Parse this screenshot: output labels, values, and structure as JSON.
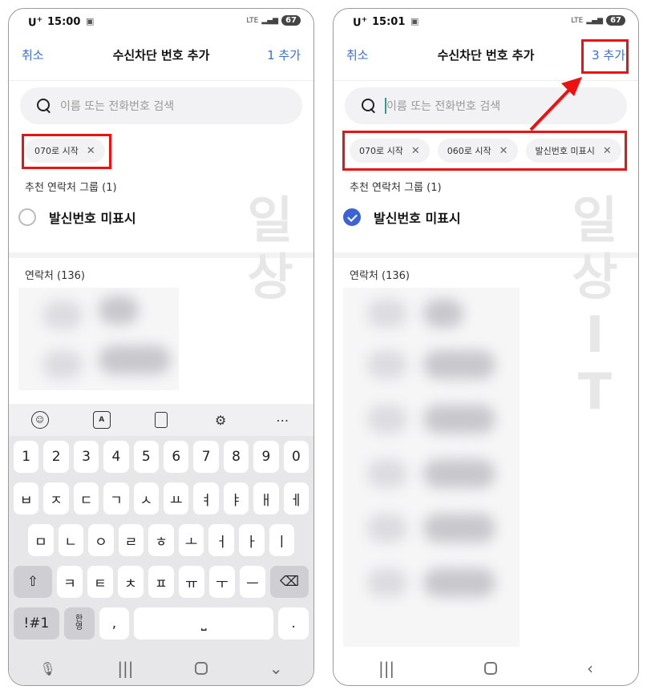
{
  "left": {
    "status": {
      "carrier": "U",
      "carrier_sup": "+",
      "time": "15:00",
      "network": "LTE",
      "battery": "67"
    },
    "header": {
      "cancel": "취소",
      "title": "수신차단 번호 추가",
      "add": "1 추가"
    },
    "search": {
      "placeholder": "이름 또는 전화번호 검색"
    },
    "chips": [
      {
        "label": "070로 시작"
      }
    ],
    "group_section": "추천 연락처 그룹 (1)",
    "group_item": "발신번호 미표시",
    "contacts_section": "연락처 (136)",
    "keyboard": {
      "row1": [
        "1",
        "2",
        "3",
        "4",
        "5",
        "6",
        "7",
        "8",
        "9",
        "0"
      ],
      "row2": [
        "ㅂ",
        "ㅈ",
        "ㄷ",
        "ㄱ",
        "ㅅ",
        "ㅛ",
        "ㅕ",
        "ㅑ",
        "ㅐ",
        "ㅔ"
      ],
      "row3": [
        "ㅁ",
        "ㄴ",
        "ㅇ",
        "ㄹ",
        "ㅎ",
        "ㅗ",
        "ㅓ",
        "ㅏ",
        "ㅣ"
      ],
      "row4": [
        "ㅋ",
        "ㅌ",
        "ㅊ",
        "ㅍ",
        "ㅠ",
        "ㅜ",
        "ㅡ"
      ],
      "sym": "!#1",
      "lang_top": "한",
      "lang_bottom": "영",
      "comma": ",",
      "period": "."
    }
  },
  "right": {
    "status": {
      "carrier": "U",
      "carrier_sup": "+",
      "time": "15:01",
      "network": "LTE",
      "battery": "67"
    },
    "header": {
      "cancel": "취소",
      "title": "수신차단 번호 추가",
      "add": "3 추가"
    },
    "search": {
      "placeholder": "이름 또는 전화번호 검색"
    },
    "chips": [
      {
        "label": "070로 시작"
      },
      {
        "label": "060로 시작"
      },
      {
        "label": "발신번호 미표시"
      }
    ],
    "group_section": "추천 연락처 그룹 (1)",
    "group_item": "발신번호 미표시",
    "contacts_section": "연락처 (136)"
  },
  "watermark": [
    "일",
    "상",
    "I",
    "T"
  ],
  "colors": {
    "accent": "#3b6fd6",
    "highlight": "#e11111",
    "checked": "#3b63d6"
  }
}
